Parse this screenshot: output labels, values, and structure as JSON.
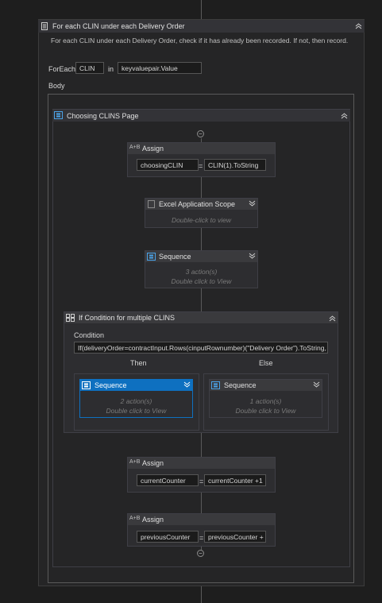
{
  "foreach": {
    "title": "For each CLIN under each Delivery Order",
    "description": "For each CLIN under each Delivery Order, check if it has already been recorded. If not, then record.",
    "foreach_label": "ForEach",
    "item": "CLIN",
    "in_label": "in",
    "values": "keyvaluepair.Value",
    "body_label": "Body"
  },
  "sequence": {
    "title": "Choosing CLINS Page"
  },
  "assign1": {
    "title": "Assign",
    "to": "choosingCLIN",
    "eq": "=",
    "value": "CLIN(1).ToString"
  },
  "excel": {
    "title": "Excel Application Scope",
    "hint": "Double-click to view"
  },
  "seq2": {
    "title": "Sequence",
    "count": "3 action(s)",
    "hint": "Double click to View"
  },
  "ifc": {
    "title": "If Condition for multiple CLINS",
    "condition_label": "Condition",
    "condition": "If(deliveryOrder=contractInput.Rows(cinputRownumber)(\"Delivery Order\").ToString,",
    "then_label": "Then",
    "else_label": "Else",
    "then_seq": {
      "title": "Sequence",
      "count": "2 action(s)",
      "hint": "Double click to View"
    },
    "else_seq": {
      "title": "Sequence",
      "count": "1 action(s)",
      "hint": "Double click to View"
    }
  },
  "assign2": {
    "title": "Assign",
    "to": "currentCounter",
    "eq": "=",
    "value": "currentCounter +1"
  },
  "assign3": {
    "title": "Assign",
    "to": "previousCounter",
    "eq": "=",
    "value": "previousCounter +"
  },
  "colors": {
    "selected": "#0e70c0",
    "background": "#1e1e1e",
    "panel": "#252526"
  }
}
